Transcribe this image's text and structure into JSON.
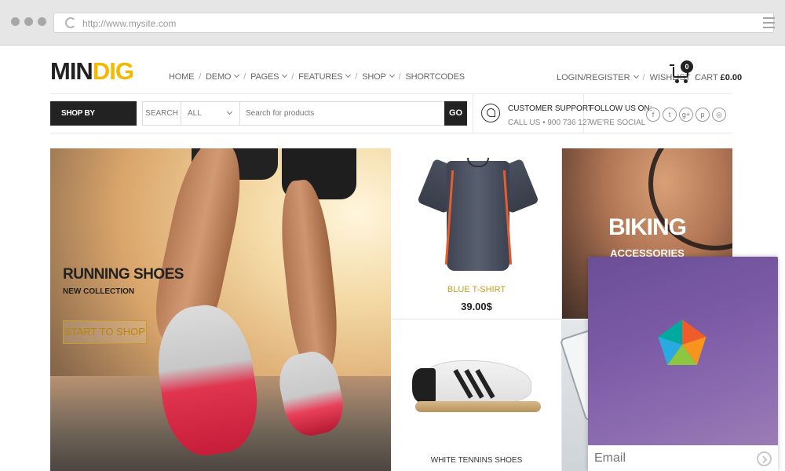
{
  "browser": {
    "url": "http://www.mysite.com"
  },
  "header": {
    "logo_part1": "MIN",
    "logo_part2": "DIG",
    "nav": [
      {
        "label": "HOME"
      },
      {
        "label": "DEMO"
      },
      {
        "label": "PAGES"
      },
      {
        "label": "FEATURES"
      },
      {
        "label": "SHOP"
      },
      {
        "label": "SHORTCODES"
      }
    ],
    "login_label": "LOGIN/REGISTER",
    "wishlist_label": "WISHLIST",
    "cart_count": "0",
    "cart_label": "CART",
    "cart_total": "£0.00"
  },
  "searchbar": {
    "category_button": "SHOP BY CATEGORY",
    "search_label": "SEARCH",
    "select_value": "ALL",
    "placeholder": "Search for products",
    "go_label": "GO"
  },
  "support": {
    "title": "CUSTOMER SUPPORT",
    "detail": "CALL US • 900 736 127"
  },
  "follow": {
    "title": "FOLLOW US ON:",
    "detail": "WE'RE SOCIAL",
    "icons": [
      "facebook-icon",
      "twitter-icon",
      "google-plus-icon",
      "pinterest-icon",
      "instagram-icon"
    ],
    "glyphs": [
      "f",
      "t",
      "g+",
      "p",
      "◎"
    ]
  },
  "hero": {
    "title": "RUNNING SHOES",
    "subtitle": "NEW COLLECTION",
    "button": "START TO SHOP"
  },
  "products": {
    "tshirt_name": "BLUE T-SHIRT",
    "tshirt_price": "39.00$",
    "shoes_name": "WHITE TENNINS SHOES"
  },
  "biking": {
    "title": "BIKING",
    "subtitle": "ACCESSORIES"
  },
  "widget": {
    "email_placeholder": "Email",
    "colors": [
      "#f15a29",
      "#f7941d",
      "#8dc63f",
      "#29abe2",
      "#00a99d"
    ]
  }
}
